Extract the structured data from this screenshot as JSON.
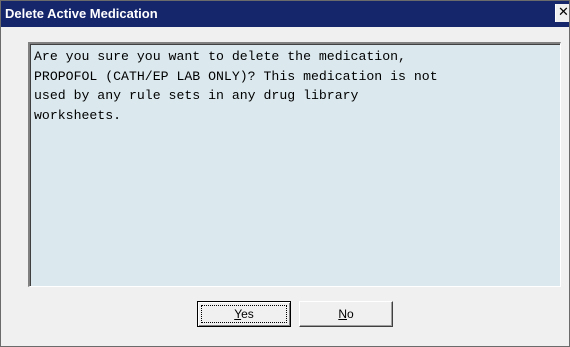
{
  "dialog": {
    "title": "Delete Active Medication",
    "close_glyph": "✕",
    "message": "Are you sure you want to delete the medication,\nPROPOFOL (CATH/EP LAB ONLY)? This medication is not\nused by any rule sets in any drug library\nworksheets.",
    "buttons": {
      "yes": {
        "accel": "Y",
        "rest": "es"
      },
      "no": {
        "accel": "N",
        "rest": "o"
      }
    }
  },
  "colors": {
    "titlebar": "#16266b",
    "message_background": "#dbe9ee",
    "dialog_background": "#f0f0f0"
  }
}
